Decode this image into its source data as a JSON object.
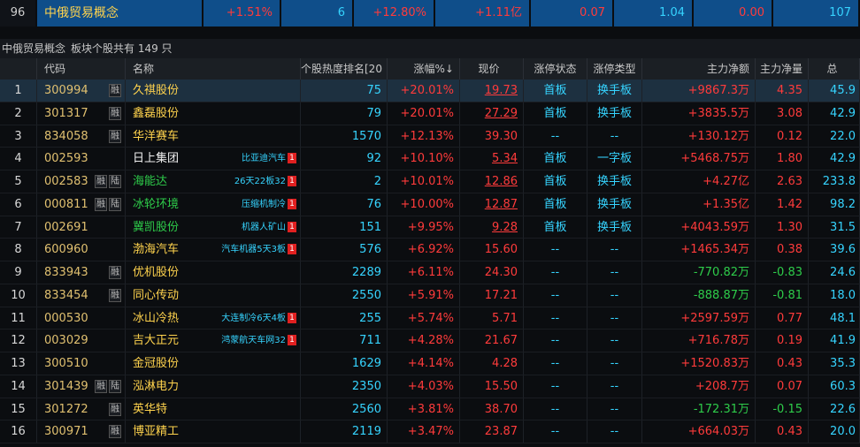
{
  "sector": {
    "index": "96",
    "name": "中俄贸易概念",
    "change": "+1.51%",
    "col3": "6",
    "col4": "+12.80%",
    "col5": "+1.11亿",
    "col6": "0.07",
    "col7": "1.04",
    "col8": "0.00",
    "col9": "107"
  },
  "caption": {
    "title": "中俄贸易概念",
    "count": "板块个股共有 149 只"
  },
  "columns": {
    "code": "代码",
    "name": "名称",
    "hot": "个股热度排名[20",
    "chg": "涨幅%↓",
    "price": "现价",
    "stat": "涨停状态",
    "type": "涨停类型",
    "flow": "主力净额",
    "vol": "主力净量",
    "tot": "总"
  },
  "colors": {
    "up": "#ff3b3b",
    "down": "#2ecc4a",
    "accent": "#36d4ff",
    "header_blue": "#0f4e8a"
  },
  "rows": [
    {
      "idx": "1",
      "code": "300994",
      "tags": [
        "融"
      ],
      "name": "久祺股份",
      "nameColor": "yellow",
      "concept": "",
      "hot": "75",
      "chg": "+20.01%",
      "price": "19.73",
      "priceUl": true,
      "stat": "首板",
      "type": "换手板",
      "flow": "+9867.3万",
      "flowDir": "up",
      "vol": "4.35",
      "volDir": "up",
      "tot": "45.9"
    },
    {
      "idx": "2",
      "code": "301317",
      "tags": [
        "融"
      ],
      "name": "鑫磊股份",
      "nameColor": "yellow",
      "concept": "",
      "hot": "79",
      "chg": "+20.01%",
      "price": "27.29",
      "priceUl": true,
      "stat": "首板",
      "type": "换手板",
      "flow": "+3835.5万",
      "flowDir": "up",
      "vol": "3.08",
      "volDir": "up",
      "tot": "42.9"
    },
    {
      "idx": "3",
      "code": "834058",
      "tags": [
        "融"
      ],
      "name": "华洋赛车",
      "nameColor": "yellow",
      "concept": "",
      "hot": "1570",
      "chg": "+12.13%",
      "price": "39.30",
      "priceUl": false,
      "stat": "--",
      "type": "--",
      "flow": "+130.12万",
      "flowDir": "up",
      "vol": "0.12",
      "volDir": "up",
      "tot": "22.0"
    },
    {
      "idx": "4",
      "code": "002593",
      "tags": [],
      "name": "日上集团",
      "nameColor": "white",
      "concept": "比亚迪汽车",
      "hot": "92",
      "chg": "+10.10%",
      "price": "5.34",
      "priceUl": true,
      "stat": "首板",
      "type": "一字板",
      "flow": "+5468.75万",
      "flowDir": "up",
      "vol": "1.80",
      "volDir": "up",
      "tot": "42.9"
    },
    {
      "idx": "5",
      "code": "002583",
      "tags": [
        "融",
        "陆"
      ],
      "name": "海能达",
      "nameColor": "green",
      "concept": "26天22板32",
      "hot": "2",
      "chg": "+10.01%",
      "price": "12.86",
      "priceUl": true,
      "stat": "首板",
      "type": "换手板",
      "flow": "+4.27亿",
      "flowDir": "up",
      "vol": "2.63",
      "volDir": "up",
      "tot": "233.8"
    },
    {
      "idx": "6",
      "code": "000811",
      "tags": [
        "融",
        "陆"
      ],
      "name": "冰轮环境",
      "nameColor": "green",
      "concept": "压缩机制冷",
      "hot": "76",
      "chg": "+10.00%",
      "price": "12.87",
      "priceUl": true,
      "stat": "首板",
      "type": "换手板",
      "flow": "+1.35亿",
      "flowDir": "up",
      "vol": "1.42",
      "volDir": "up",
      "tot": "98.2"
    },
    {
      "idx": "7",
      "code": "002691",
      "tags": [],
      "name": "冀凯股份",
      "nameColor": "green",
      "concept": "机器人矿山",
      "hot": "151",
      "chg": "+9.95%",
      "price": "9.28",
      "priceUl": true,
      "stat": "首板",
      "type": "换手板",
      "flow": "+4043.59万",
      "flowDir": "up",
      "vol": "1.30",
      "volDir": "up",
      "tot": "31.5"
    },
    {
      "idx": "8",
      "code": "600960",
      "tags": [],
      "name": "渤海汽车",
      "nameColor": "yellow",
      "concept": "汽车机器5天3板",
      "hot": "576",
      "chg": "+6.92%",
      "price": "15.60",
      "priceUl": false,
      "stat": "--",
      "type": "--",
      "flow": "+1465.34万",
      "flowDir": "up",
      "vol": "0.38",
      "volDir": "up",
      "tot": "39.6"
    },
    {
      "idx": "9",
      "code": "833943",
      "tags": [
        "融"
      ],
      "name": "优机股份",
      "nameColor": "yellow",
      "concept": "",
      "hot": "2289",
      "chg": "+6.11%",
      "price": "24.30",
      "priceUl": false,
      "stat": "--",
      "type": "--",
      "flow": "-770.82万",
      "flowDir": "dn",
      "vol": "-0.83",
      "volDir": "dn",
      "tot": "24.6"
    },
    {
      "idx": "10",
      "code": "833454",
      "tags": [
        "融"
      ],
      "name": "同心传动",
      "nameColor": "yellow",
      "concept": "",
      "hot": "2550",
      "chg": "+5.91%",
      "price": "17.21",
      "priceUl": false,
      "stat": "--",
      "type": "--",
      "flow": "-888.87万",
      "flowDir": "dn",
      "vol": "-0.81",
      "volDir": "dn",
      "tot": "18.0"
    },
    {
      "idx": "11",
      "code": "000530",
      "tags": [],
      "name": "冰山冷热",
      "nameColor": "yellow",
      "concept": "大连制冷6天4板",
      "hot": "255",
      "chg": "+5.74%",
      "price": "5.71",
      "priceUl": false,
      "stat": "--",
      "type": "--",
      "flow": "+2597.59万",
      "flowDir": "up",
      "vol": "0.77",
      "volDir": "up",
      "tot": "48.1"
    },
    {
      "idx": "12",
      "code": "003029",
      "tags": [],
      "name": "吉大正元",
      "nameColor": "yellow",
      "concept": "鸿蒙航天车网32",
      "hot": "711",
      "chg": "+4.28%",
      "price": "21.67",
      "priceUl": false,
      "stat": "--",
      "type": "--",
      "flow": "+716.78万",
      "flowDir": "up",
      "vol": "0.19",
      "volDir": "up",
      "tot": "41.9"
    },
    {
      "idx": "13",
      "code": "300510",
      "tags": [],
      "name": "金冠股份",
      "nameColor": "yellow",
      "concept": "",
      "hot": "1629",
      "chg": "+4.14%",
      "price": "4.28",
      "priceUl": false,
      "stat": "--",
      "type": "--",
      "flow": "+1520.83万",
      "flowDir": "up",
      "vol": "0.43",
      "volDir": "up",
      "tot": "35.3"
    },
    {
      "idx": "14",
      "code": "301439",
      "tags": [
        "融",
        "陆"
      ],
      "name": "泓淋电力",
      "nameColor": "yellow",
      "concept": "",
      "hot": "2350",
      "chg": "+4.03%",
      "price": "15.50",
      "priceUl": false,
      "stat": "--",
      "type": "--",
      "flow": "+208.7万",
      "flowDir": "up",
      "vol": "0.07",
      "volDir": "up",
      "tot": "60.3"
    },
    {
      "idx": "15",
      "code": "301272",
      "tags": [
        "融"
      ],
      "name": "英华特",
      "nameColor": "yellow",
      "concept": "",
      "hot": "2560",
      "chg": "+3.81%",
      "price": "38.70",
      "priceUl": false,
      "stat": "--",
      "type": "--",
      "flow": "-172.31万",
      "flowDir": "dn",
      "vol": "-0.15",
      "volDir": "dn",
      "tot": "22.6"
    },
    {
      "idx": "16",
      "code": "300971",
      "tags": [
        "融"
      ],
      "name": "博亚精工",
      "nameColor": "yellow",
      "concept": "",
      "hot": "2119",
      "chg": "+3.47%",
      "price": "23.87",
      "priceUl": false,
      "stat": "--",
      "type": "--",
      "flow": "+664.03万",
      "flowDir": "up",
      "vol": "0.43",
      "volDir": "up",
      "tot": "20.0"
    }
  ]
}
